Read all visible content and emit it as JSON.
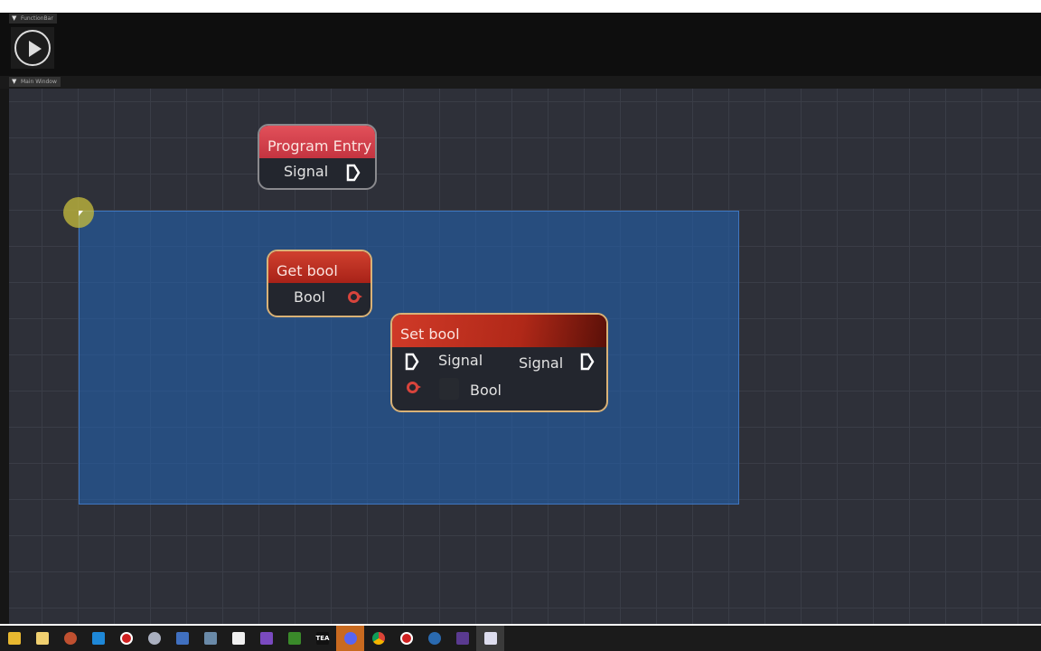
{
  "panels": {
    "function_bar": "FunctionBar",
    "main_window": "Main Window"
  },
  "nodes": {
    "program_entry": {
      "title": "Program Entry",
      "output": "Signal"
    },
    "get_bool": {
      "title": "Get bool",
      "output": "Bool"
    },
    "set_bool": {
      "title": "Set bool",
      "input_signal": "Signal",
      "output_signal": "Signal",
      "input_bool": "Bool"
    }
  },
  "taskbar": {
    "icons": [
      "file-explorer",
      "microsoft-store",
      "app",
      "mail",
      "recorder",
      "app",
      "network-app",
      "calculator",
      "notepad",
      "visual-studio",
      "minecraft",
      "tea",
      "discord",
      "chrome",
      "recorder",
      "steam",
      "terminal",
      "current-app"
    ],
    "tea_label": "TEA",
    "active_index": 12
  }
}
